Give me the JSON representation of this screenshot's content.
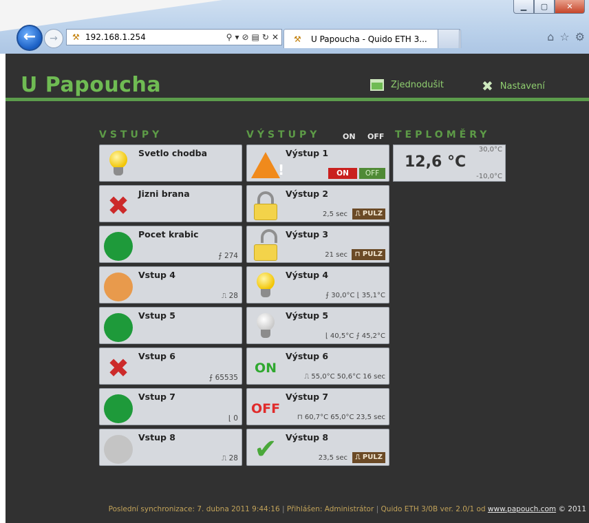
{
  "browser": {
    "url": "192.168.1.254",
    "tab_title": "U Papoucha - Quido ETH 3...",
    "close_glyph": "✕",
    "minimize_glyph": "▁",
    "maximize_glyph": "▢"
  },
  "header": {
    "title": "U Papoucha",
    "simplify_label": "Zjednodušit",
    "settings_label": "Nastavení"
  },
  "sections": {
    "inputs": "VSTUPY",
    "outputs": "VÝSTUPY",
    "on": "ON",
    "off": "OFF",
    "thermometers": "TEPLOMĚRY"
  },
  "inputs": [
    {
      "name": "Svetlo chodba",
      "info": "",
      "icon": "lightbulb-on-icon"
    },
    {
      "name": "Jizni brana",
      "info": "",
      "icon": "red-x-icon"
    },
    {
      "name": "Pocet krabic",
      "info": "⨍ 274",
      "icon": "green-dot-icon",
      "color": "#1e9a3a"
    },
    {
      "name": "Vstup 4",
      "info": "⎍ 28",
      "icon": "orange-dot-icon",
      "color": "#e89a4c"
    },
    {
      "name": "Vstup 5",
      "info": "",
      "icon": "green-dot-icon",
      "color": "#1e9a3a"
    },
    {
      "name": "Vstup 6",
      "info": "⨍ 65535",
      "icon": "red-x-icon"
    },
    {
      "name": "Vstup 7",
      "info": "⌊ 0",
      "icon": "green-dot-icon",
      "color": "#1e9a3a"
    },
    {
      "name": "Vstup 8",
      "info": "⎍ 28",
      "icon": "gray-dot-icon",
      "color": "#c4c4c4"
    }
  ],
  "outputs": [
    {
      "name": "Výstup 1",
      "on": "ON",
      "off": "OFF"
    },
    {
      "name": "Výstup 2",
      "info": "2,5 sec",
      "pulz": "⎍ PULZ"
    },
    {
      "name": "Výstup 3",
      "info": "21 sec",
      "pulz": "⊓ PULZ"
    },
    {
      "name": "Výstup 4",
      "info": "⨍ 30,0°C ⌊ 35,1°C"
    },
    {
      "name": "Výstup 5",
      "info": "⌊ 40,5°C ⨍ 45,2°C"
    },
    {
      "name": "Výstup 6",
      "info": "⎍ 55,0°C 50,6°C 16 sec",
      "state_text": "ON"
    },
    {
      "name": "Výstup 7",
      "info": "⊓ 60,7°C 65,0°C 23,5 sec",
      "state_text": "OFF"
    },
    {
      "name": "Výstup 8",
      "info": "23,5 sec",
      "pulz": "⎍ PULZ"
    }
  ],
  "thermometer": {
    "value": "12,6 °C",
    "max": "30,0°C",
    "min": "-10,0°C"
  },
  "footer": {
    "sync_label": "Poslední synchronizace: 7. dubna 2011 9:44:16",
    "login_label": "Přihlášen: Administrátor",
    "device_label": "Quido ETH 3/0B ver. 2.0/1 od",
    "link": "www.papouch.com",
    "year": "© 2011",
    "sep": "|"
  },
  "colors": {
    "accent": "#6fbb53",
    "page_bg": "#313131",
    "tile_bg": "#d6d9de"
  }
}
